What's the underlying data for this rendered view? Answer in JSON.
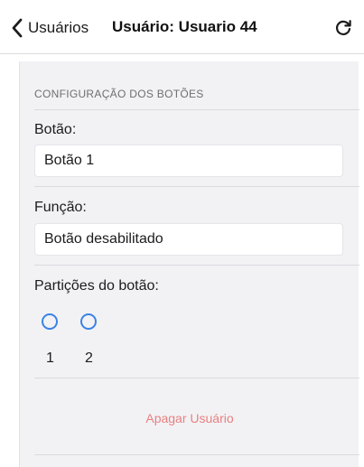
{
  "nav": {
    "back_label": "Usuários",
    "title": "Usuário: Usuario 44"
  },
  "section": {
    "header": "CONFIGURAÇÃO DOS BOTÕES"
  },
  "fields": {
    "button_label": "Botão:",
    "button_value": "Botão 1",
    "function_label": "Função:",
    "function_value": "Botão desabilitado"
  },
  "partitions": {
    "label": "Partições do botão:",
    "options": [
      {
        "label": "1",
        "selected": false
      },
      {
        "label": "2",
        "selected": false
      }
    ]
  },
  "actions": {
    "delete_label": "Apagar Usuário"
  },
  "colors": {
    "accent": "#3b82e6",
    "destructive": "#e8817f"
  },
  "icons": {
    "back": "chevron-left-icon",
    "refresh": "refresh-icon"
  }
}
